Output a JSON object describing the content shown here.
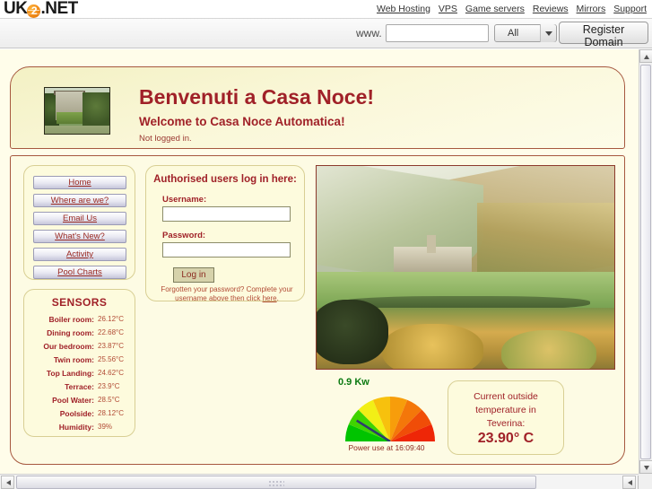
{
  "uk2_header": {
    "logo_text_1": "UK",
    "logo_globe": "2",
    "logo_text_2": ".NET",
    "nav": [
      {
        "label": "Web Hosting"
      },
      {
        "label": "VPS"
      },
      {
        "label": "Game servers"
      },
      {
        "label": "Reviews"
      },
      {
        "label": "Mirrors"
      },
      {
        "label": "Support"
      }
    ]
  },
  "domain_bar": {
    "www_prefix": "www.",
    "domain_value": "",
    "domain_placeholder": "",
    "tld_selected": "All",
    "tld_options": [
      "All"
    ],
    "register_label": "Register Domain"
  },
  "banner": {
    "title": "Benvenuti a Casa Noce!",
    "subtitle": "Welcome to Casa Noce Automatica!",
    "login_status": "Not logged in.",
    "thumbnail_name": "casa-noce-villa-thumbnail"
  },
  "nav_panel": {
    "buttons": [
      {
        "label": "Home",
        "name": "nav-home"
      },
      {
        "label": "Where are we?",
        "name": "nav-where-are-we"
      },
      {
        "label": "Email Us",
        "name": "nav-email-us"
      },
      {
        "label": "What's New?",
        "name": "nav-whats-new"
      },
      {
        "label": "Activity",
        "name": "nav-activity"
      },
      {
        "label": "Pool Charts",
        "name": "nav-pool-charts"
      }
    ]
  },
  "sensors": {
    "title": "SENSORS",
    "readings": [
      {
        "label": "Boiler room:",
        "value": "26.12°C"
      },
      {
        "label": "Dining room:",
        "value": "22.68°C"
      },
      {
        "label": "Our bedroom:",
        "value": "23.87°C"
      },
      {
        "label": "Twin room:",
        "value": "25.56°C"
      },
      {
        "label": "Top Landing:",
        "value": "24.62°C"
      },
      {
        "label": "Terrace:",
        "value": "23.9°C"
      },
      {
        "label": "Pool Water:",
        "value": "28.5°C"
      },
      {
        "label": "Poolside:",
        "value": "28.12°C"
      },
      {
        "label": "Humidity:",
        "value": "39%"
      }
    ]
  },
  "login": {
    "title": "Authorised users log in here:",
    "username_label": "Username:",
    "username_value": "",
    "password_label": "Password:",
    "password_value": "",
    "submit_label": "Log in",
    "forgot_text_before": "Forgotten your password? Complete your username above then click ",
    "forgot_link": "here",
    "forgot_text_after": "."
  },
  "photo": {
    "name": "teverina-valley-landscape-photo"
  },
  "gauge": {
    "reading": "0.9 Kw",
    "caption": "Power use at 16:09:40",
    "needle_angle_deg": -58,
    "segment_colors": [
      "#00c400",
      "#3fd400",
      "#f2ef16",
      "#f7c10d",
      "#f79d0b",
      "#f4770a",
      "#f04d08",
      "#ee2607"
    ],
    "reading_color": "#0c7a12"
  },
  "outside_temp": {
    "line1": "Current outside",
    "line2": "temperature in",
    "line3": "Teverina:",
    "value": "23.90° C"
  },
  "colors": {
    "page_bg": "#fffdea",
    "panel_bg": "#fdfbdd",
    "panel_border": "#d8cf94",
    "frame_border": "#a6583f",
    "heading_red": "#a02128",
    "text_red": "#b24b35",
    "accent_orange": "#f08a18"
  }
}
